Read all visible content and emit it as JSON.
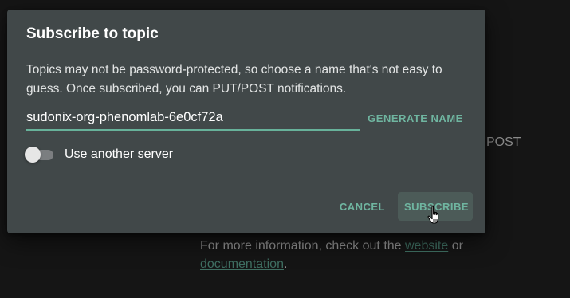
{
  "background": {
    "fragment_text": "POST",
    "info": {
      "prefix": "For more information, check out the ",
      "link1": "website",
      "middle": " or",
      "link2": "documentation",
      "suffix": "."
    }
  },
  "dialog": {
    "title": "Subscribe to topic",
    "description": "Topics may not be password-protected, so choose a name that's not easy to guess. Once subscribed, you can PUT/POST notifications.",
    "topic_input": {
      "value": "sudonix-org-phenomlab-6e0cf72a",
      "placeholder": ""
    },
    "generate_name_label": "GENERATE NAME",
    "server_toggle": {
      "label": "Use another server",
      "checked": false
    },
    "cancel_label": "CANCEL",
    "subscribe_label": "SUBSCRIBE"
  },
  "colors": {
    "accent": "#6fb5a0",
    "dialog_bg": "#414849",
    "page_bg": "#151515"
  }
}
